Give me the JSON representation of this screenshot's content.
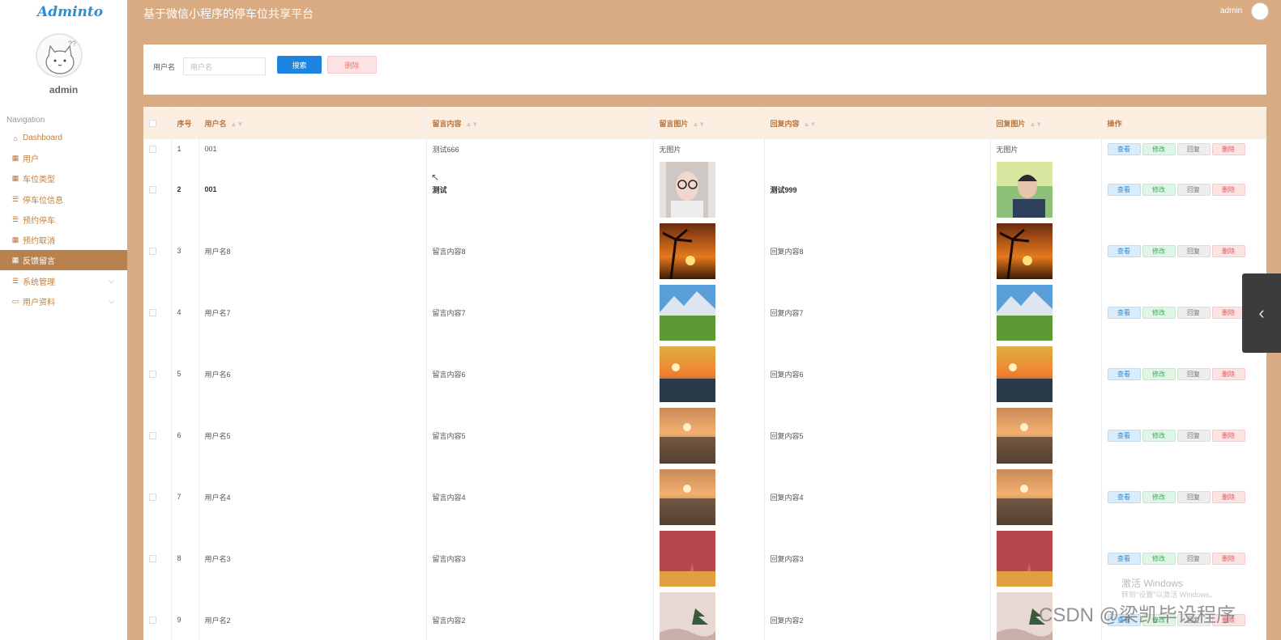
{
  "app": {
    "brand": "Adminto",
    "title": "基于微信小程序的停车位共享平台",
    "user": "admin"
  },
  "sidebar": {
    "username": "admin",
    "section": "Navigation",
    "items": [
      {
        "label": "Dashboard",
        "icon": "home-icon"
      },
      {
        "label": "用户",
        "icon": "grid-icon"
      },
      {
        "label": "车位类型",
        "icon": "grid-icon"
      },
      {
        "label": "停车位信息",
        "icon": "list-icon"
      },
      {
        "label": "预约停车",
        "icon": "list-icon"
      },
      {
        "label": "预约取消",
        "icon": "grid-icon"
      },
      {
        "label": "反馈留言",
        "icon": "grid-icon",
        "active": true
      },
      {
        "label": "系统管理",
        "icon": "list-icon",
        "expandable": true
      },
      {
        "label": "用户资料",
        "icon": "card-icon",
        "expandable": true
      }
    ]
  },
  "search": {
    "label": "用户名",
    "placeholder": "用户名",
    "search_btn": "搜索",
    "delete_btn": "删除"
  },
  "table": {
    "headers": {
      "no": "序号",
      "username": "用户名",
      "content": "留言内容",
      "image": "留言图片",
      "reply": "回复内容",
      "reply_image": "回复图片",
      "ops": "操作"
    },
    "ops": {
      "view": "查看",
      "edit": "修改",
      "reply": "回复",
      "delete": "删除"
    },
    "rows": [
      {
        "no": "1",
        "username": "001",
        "content": "测试666",
        "image": "无图片",
        "reply": "",
        "reply_image": "无图片"
      },
      {
        "no": "2",
        "username": "001",
        "content": "测试",
        "image": "portrait-woman",
        "reply": "测试999",
        "reply_image": "portrait-man",
        "bold": true
      },
      {
        "no": "3",
        "username": "用户名8",
        "content": "留言内容8",
        "image": "palm-sunset",
        "reply": "回复内容8",
        "reply_image": "palm-sunset"
      },
      {
        "no": "4",
        "username": "用户名7",
        "content": "留言内容7",
        "image": "mountain-meadow",
        "reply": "回复内容7",
        "reply_image": "mountain-meadow"
      },
      {
        "no": "5",
        "username": "用户名6",
        "content": "留言内容6",
        "image": "sea-sunset",
        "reply": "回复内容6",
        "reply_image": "sea-sunset"
      },
      {
        "no": "6",
        "username": "用户名5",
        "content": "留言内容5",
        "image": "beach-sunset",
        "reply": "回复内容5",
        "reply_image": "beach-sunset"
      },
      {
        "no": "7",
        "username": "用户名4",
        "content": "留言内容4",
        "image": "beach-sunset",
        "reply": "回复内容4",
        "reply_image": "beach-sunset"
      },
      {
        "no": "8",
        "username": "用户名3",
        "content": "留言内容3",
        "image": "red-forest",
        "reply": "回复内容3",
        "reply_image": "red-forest"
      },
      {
        "no": "9",
        "username": "用户名2",
        "content": "留言内容2",
        "image": "misty-pine",
        "reply": "回复内容2",
        "reply_image": "misty-pine"
      }
    ]
  },
  "watermark": {
    "line1": "激活 Windows",
    "line2": "转到\"设置\"以激活 Windows。",
    "csdn": "CSDN @梁凯毕设程序"
  },
  "colors": {
    "primary": "#d9ab82",
    "accent": "#b8814d",
    "link": "#1d85e0"
  }
}
